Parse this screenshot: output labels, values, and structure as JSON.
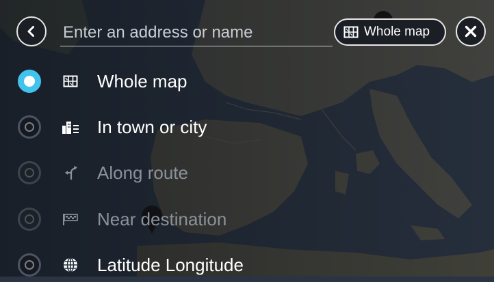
{
  "search": {
    "placeholder": "Enter an address or name"
  },
  "scope_chip": {
    "label": "Whole map",
    "icon": "map-grid-icon"
  },
  "options": [
    {
      "label": "Whole map",
      "icon": "map-grid-icon",
      "selected": true,
      "enabled": true
    },
    {
      "label": "In town or city",
      "icon": "city-buildings-icon",
      "selected": false,
      "enabled": true
    },
    {
      "label": "Along route",
      "icon": "along-route-icon",
      "selected": false,
      "enabled": false
    },
    {
      "label": "Near destination",
      "icon": "checkered-flag-icon",
      "selected": false,
      "enabled": false
    },
    {
      "label": "Latitude Longitude",
      "icon": "globe-icon",
      "selected": false,
      "enabled": true
    }
  ],
  "colors": {
    "accent": "#42c3ee",
    "sea": "#2a3442",
    "land": "#4a4a44"
  }
}
